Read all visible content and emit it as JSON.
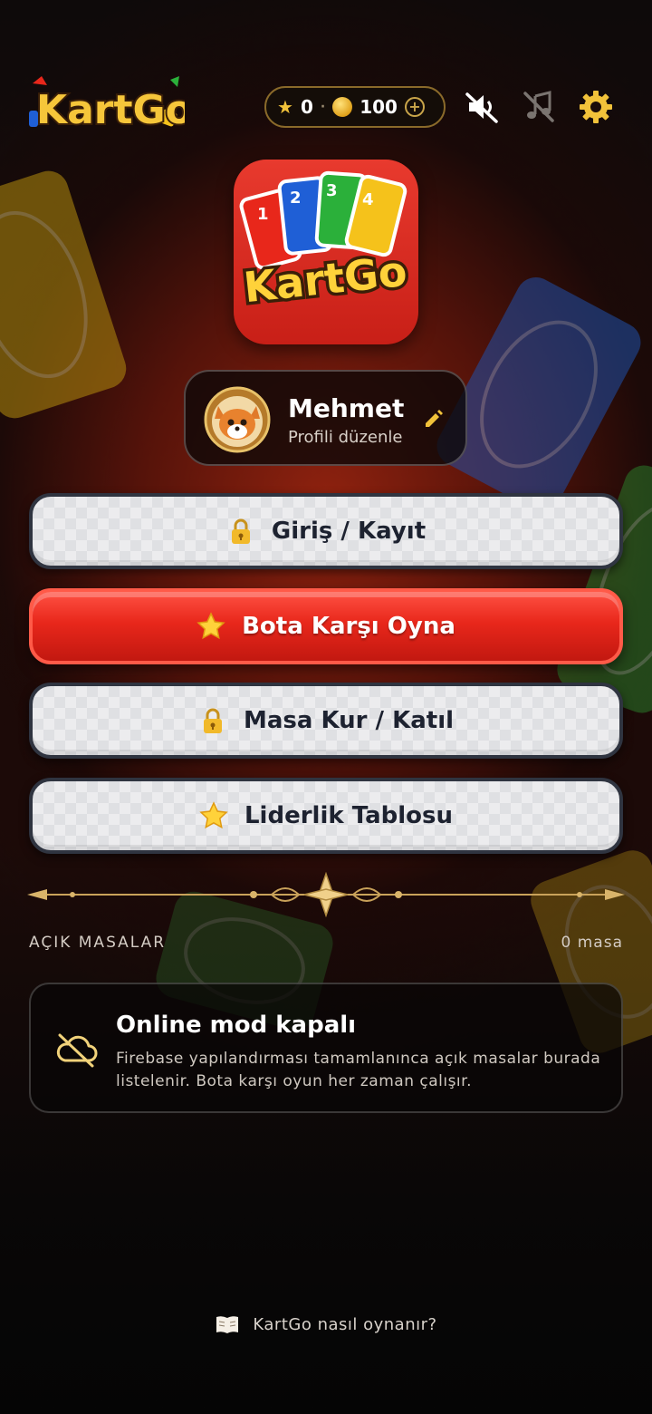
{
  "header": {
    "logo_text": "KartGo",
    "stars": "0",
    "separator": "·",
    "coins": "100",
    "plus": "+"
  },
  "app_logo_text": "KartGo",
  "app_logo_cards": [
    "1",
    "2",
    "3",
    "4"
  ],
  "profile": {
    "name": "Mehmet",
    "subtitle": "Profili düzenle"
  },
  "menu": {
    "login_label": "Giriş / Kayıt",
    "bot_label": "Bota Karşı Oyna",
    "table_label": "Masa Kur / Katıl",
    "leaderboard_label": "Liderlik Tablosu"
  },
  "open_tables": {
    "title": "AÇIK MASALAR",
    "count": "0 masa"
  },
  "offline": {
    "title": "Online mod kapalı",
    "description": "Firebase yapılandırması tamamlanınca açık masalar burada listelenir. Bota karşı oyun her zaman çalışır."
  },
  "footer": {
    "howto_label": "KartGo nasıl oynanır?"
  },
  "icons": {
    "sound": "speaker-muted-icon",
    "music": "music-off-icon",
    "settings": "gear-icon",
    "lock": "lock-icon",
    "star": "star-icon",
    "cloud": "cloud-off-icon",
    "book": "book-icon",
    "edit": "pencil-icon"
  },
  "colors": {
    "primary_red": "#e8271b",
    "gold": "#f1c23a",
    "button_dark_border": "#2f3440"
  }
}
